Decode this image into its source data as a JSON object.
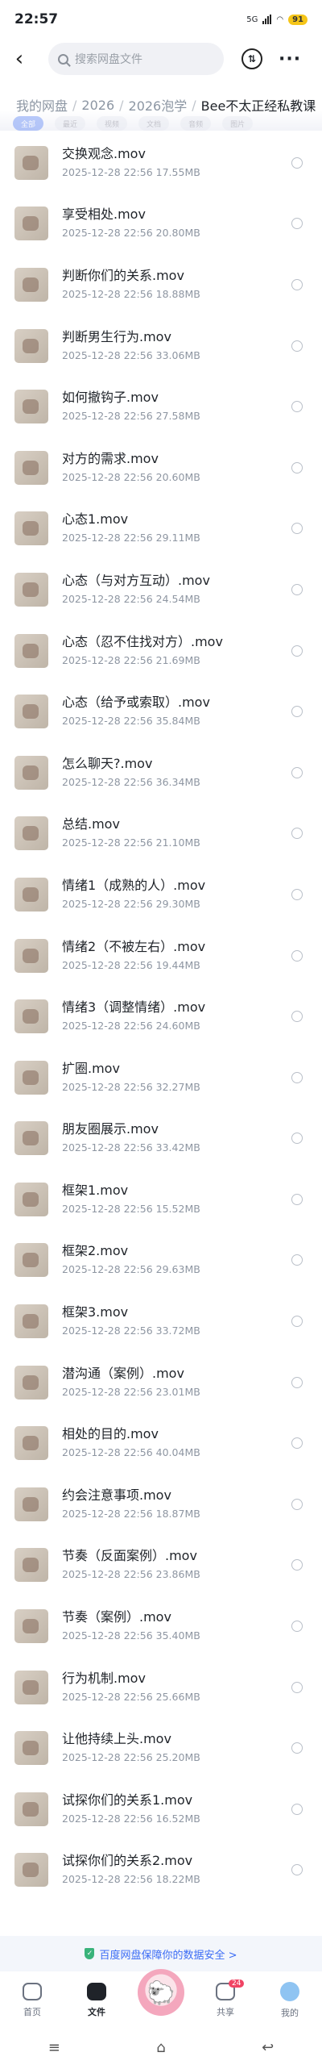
{
  "status_bar": {
    "time": "22:57",
    "battery": "91",
    "network": "5G"
  },
  "header": {
    "search_placeholder": "搜索网盘文件"
  },
  "breadcrumb": [
    "我的网盘",
    "2026",
    "2026泡学",
    "Bee不太正经私教课"
  ],
  "filters": [
    "全部",
    "最近",
    "视频",
    "文档",
    "音频",
    "图片"
  ],
  "files": [
    {
      "name": "交换观念.mov",
      "date": "2025-12-28",
      "time": "22:56",
      "size": "17.55MB"
    },
    {
      "name": "享受相处.mov",
      "date": "2025-12-28",
      "time": "22:56",
      "size": "20.80MB"
    },
    {
      "name": "判断你们的关系.mov",
      "date": "2025-12-28",
      "time": "22:56",
      "size": "18.88MB"
    },
    {
      "name": "判断男生行为.mov",
      "date": "2025-12-28",
      "time": "22:56",
      "size": "33.06MB"
    },
    {
      "name": "如何撤钩子.mov",
      "date": "2025-12-28",
      "time": "22:56",
      "size": "27.58MB"
    },
    {
      "name": "对方的需求.mov",
      "date": "2025-12-28",
      "time": "22:56",
      "size": "20.60MB"
    },
    {
      "name": "心态1.mov",
      "date": "2025-12-28",
      "time": "22:56",
      "size": "29.11MB"
    },
    {
      "name": "心态（与对方互动）.mov",
      "date": "2025-12-28",
      "time": "22:56",
      "size": "24.54MB"
    },
    {
      "name": "心态（忍不住找对方）.mov",
      "date": "2025-12-28",
      "time": "22:56",
      "size": "21.69MB"
    },
    {
      "name": "心态（给予或索取）.mov",
      "date": "2025-12-28",
      "time": "22:56",
      "size": "35.84MB"
    },
    {
      "name": "怎么聊天?.mov",
      "date": "2025-12-28",
      "time": "22:56",
      "size": "36.34MB"
    },
    {
      "name": "总结.mov",
      "date": "2025-12-28",
      "time": "22:56",
      "size": "21.10MB"
    },
    {
      "name": "情绪1（成熟的人）.mov",
      "date": "2025-12-28",
      "time": "22:56",
      "size": "29.30MB"
    },
    {
      "name": "情绪2（不被左右）.mov",
      "date": "2025-12-28",
      "time": "22:56",
      "size": "19.44MB"
    },
    {
      "name": "情绪3（调整情绪）.mov",
      "date": "2025-12-28",
      "time": "22:56",
      "size": "24.60MB"
    },
    {
      "name": "扩圈.mov",
      "date": "2025-12-28",
      "time": "22:56",
      "size": "32.27MB"
    },
    {
      "name": "朋友圈展示.mov",
      "date": "2025-12-28",
      "time": "22:56",
      "size": "33.42MB"
    },
    {
      "name": "框架1.mov",
      "date": "2025-12-28",
      "time": "22:56",
      "size": "15.52MB"
    },
    {
      "name": "框架2.mov",
      "date": "2025-12-28",
      "time": "22:56",
      "size": "29.63MB"
    },
    {
      "name": "框架3.mov",
      "date": "2025-12-28",
      "time": "22:56",
      "size": "33.72MB"
    },
    {
      "name": "潜沟通（案例）.mov",
      "date": "2025-12-28",
      "time": "22:56",
      "size": "23.01MB"
    },
    {
      "name": "相处的目的.mov",
      "date": "2025-12-28",
      "time": "22:56",
      "size": "40.04MB"
    },
    {
      "name": "约会注意事项.mov",
      "date": "2025-12-28",
      "time": "22:56",
      "size": "18.87MB"
    },
    {
      "name": "节奏（反面案例）.mov",
      "date": "2025-12-28",
      "time": "22:56",
      "size": "23.86MB"
    },
    {
      "name": "节奏（案例）.mov",
      "date": "2025-12-28",
      "time": "22:56",
      "size": "35.40MB"
    },
    {
      "name": "行为机制.mov",
      "date": "2025-12-28",
      "time": "22:56",
      "size": "25.66MB"
    },
    {
      "name": "让他持续上头.mov",
      "date": "2025-12-28",
      "time": "22:56",
      "size": "25.20MB"
    },
    {
      "name": "试探你们的关系1.mov",
      "date": "2025-12-28",
      "time": "22:56",
      "size": "16.52MB"
    },
    {
      "name": "试探你们的关系2.mov",
      "date": "2025-12-28",
      "time": "22:56",
      "size": "18.22MB"
    }
  ],
  "safety_banner": "百度网盘保障你的数据安全 >",
  "tabbar": {
    "home": "首页",
    "files": "文件",
    "share": "共享",
    "share_badge": "24",
    "me": "我的"
  },
  "colors": {
    "accent": "#3b6cf5",
    "badge": "#f04464",
    "meta_text": "#8e96a2"
  }
}
